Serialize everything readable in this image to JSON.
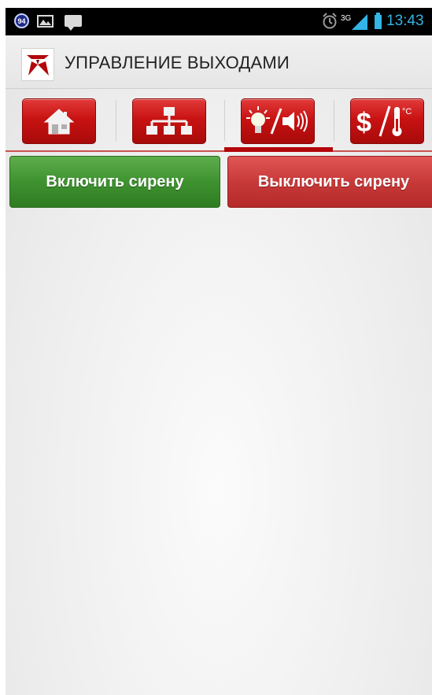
{
  "status_bar": {
    "notification_count": "94",
    "network": "3G",
    "time": "13:43"
  },
  "action_bar": {
    "title": "УПРАВЛЕНИЕ ВЫХОДАМИ"
  },
  "tabs": [
    {
      "icon": "home-icon",
      "selected": false
    },
    {
      "icon": "network-tree-icon",
      "selected": false
    },
    {
      "icon": "light-sound-icon",
      "selected": true
    },
    {
      "icon": "money-temperature-icon",
      "selected": false
    }
  ],
  "buttons": {
    "siren_on_label": "Включить сирену",
    "siren_off_label": "Выключить сирену"
  },
  "colors": {
    "accent_red": "#c81212",
    "on_green": "#3f9230",
    "off_red": "#c83a3a",
    "status_blue": "#33b5e5"
  }
}
